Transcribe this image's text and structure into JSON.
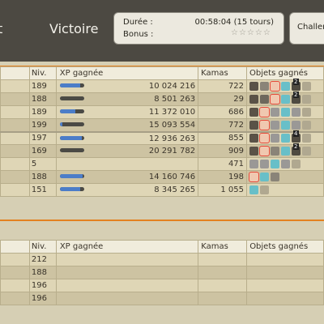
{
  "header": {
    "truncated_left": "t",
    "title": "Victoire",
    "duration_label": "Durée :",
    "duration_value": "00:58:04 (15 tours)",
    "bonus_label": "Bonus :",
    "bonus_stars": "☆☆☆☆☆",
    "challenge_label": "Challen"
  },
  "colors": {
    "accent": "#e38120",
    "xp_bar": "#4c7dc8"
  },
  "team1": {
    "headers": {
      "niv": "Niv.",
      "xp": "XP gagnée",
      "kamas": "Kamas",
      "objets": "Objets gagnés"
    },
    "rows": [
      {
        "niv": "189",
        "xp": "10 024 216",
        "xp_progress": 0.85,
        "kamas": "722",
        "items": [
          "scroll",
          "glove",
          "selected-scroll",
          "potion",
          "badge-2",
          "bow"
        ]
      },
      {
        "niv": "188",
        "xp": "8 501 263",
        "xp_progress": 0.0,
        "kamas": "29",
        "items": [
          "scroll",
          "hat",
          "selected-scroll",
          "potion",
          "badge-2",
          "bow"
        ]
      },
      {
        "niv": "189",
        "xp": "11 372 010",
        "xp_progress": 0.65,
        "kamas": "686",
        "items": [
          "scroll",
          "selected-scroll",
          "stone",
          "potion",
          "stone",
          "bow"
        ]
      },
      {
        "niv": "199",
        "xp": "15 093 554",
        "xp_progress": 0.1,
        "kamas": "772",
        "items": [
          "scroll",
          "selected-scroll",
          "stone",
          "potion",
          "stone",
          "bow"
        ]
      },
      {
        "niv": "197",
        "xp": "12 936 263",
        "xp_progress": 0.9,
        "kamas": "855",
        "items": [
          "scroll",
          "selected-scroll",
          "stone",
          "potion",
          "badge-4",
          "bow"
        ]
      },
      {
        "niv": "169",
        "xp": "20 291 782",
        "xp_progress": 0.0,
        "kamas": "909",
        "items": [
          "scroll",
          "selected-scroll",
          "glove",
          "potion",
          "badge-2",
          "bow"
        ]
      },
      {
        "niv": "5",
        "xp": "",
        "xp_progress": null,
        "kamas": "471",
        "items": [
          "stone",
          "stone",
          "potion",
          "stone",
          "bow"
        ]
      },
      {
        "niv": "188",
        "xp": "14 160 746",
        "xp_progress": 0.95,
        "kamas": "198",
        "items": [
          "selected-scroll",
          "potion",
          "glove"
        ]
      },
      {
        "niv": "151",
        "xp": "8 345 265",
        "xp_progress": 0.85,
        "kamas": "1 055",
        "items": [
          "potion",
          "bow"
        ]
      }
    ]
  },
  "team2": {
    "headers": {
      "niv": "Niv.",
      "xp": "XP gagnée",
      "kamas": "Kamas",
      "objets": "Objets gagnés"
    },
    "rows": [
      {
        "niv": "212",
        "xp": "",
        "kamas": "",
        "items": []
      },
      {
        "niv": "188",
        "xp": "",
        "kamas": "",
        "items": []
      },
      {
        "niv": "196",
        "xp": "",
        "kamas": "",
        "items": []
      },
      {
        "niv": "196",
        "xp": "",
        "kamas": "",
        "items": []
      }
    ]
  }
}
